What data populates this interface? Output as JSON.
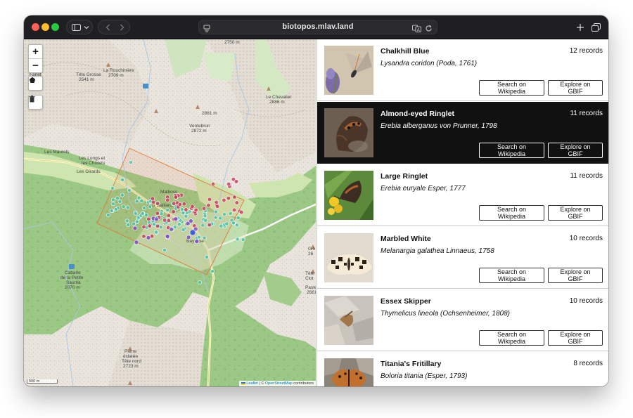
{
  "browser": {
    "url": "biotopos.mlav.land"
  },
  "map": {
    "zoom_in": "+",
    "zoom_out": "−",
    "attribution_leaflet": "Leaflet",
    "attribution_sep": " | © ",
    "attribution_osm": "OpenStreetMap",
    "attribution_tail": " contributors",
    "scale_label": "500 m",
    "places": [
      {
        "name": "2750 m"
      },
      {
        "name": "Tête Grosse"
      },
      {
        "name": "2541 m"
      },
      {
        "name": "La Rouchinière"
      },
      {
        "name": "2709 m"
      },
      {
        "name": "Le Chevalier"
      },
      {
        "name": "2886 m"
      },
      {
        "name": "2881 m"
      },
      {
        "name": "Ventebrun"
      },
      {
        "name": "2872 m"
      },
      {
        "name": "Les Maurels"
      },
      {
        "name": "Les Longs et"
      },
      {
        "name": "les Chiclets"
      },
      {
        "name": "Les Girards"
      },
      {
        "name": "Malbosc"
      },
      {
        "name": "Les Gaillards"
      },
      {
        "name": "Bayasse"
      },
      {
        "name": "Cabane"
      },
      {
        "name": "de la Petite"
      },
      {
        "name": "Sauma"
      },
      {
        "name": "2070 m"
      },
      {
        "name": "Pierre"
      },
      {
        "name": "éclatée"
      },
      {
        "name": "Tête nord"
      },
      {
        "name": "2723 m"
      },
      {
        "name": "Fanet"
      },
      {
        "name": "Glo"
      },
      {
        "name": "26"
      },
      {
        "name": "Tête"
      },
      {
        "name": "Clot"
      },
      {
        "name": "Paste"
      },
      {
        "name": "2661"
      }
    ]
  },
  "species_list": [
    {
      "common": "Chalkhill Blue",
      "scientific": "Lysandra coridon (Poda, 1761)",
      "records": "12 records",
      "wiki": "Search on Wikipedia",
      "gbif": "Explore on GBIF"
    },
    {
      "common": "Almond-eyed Ringlet",
      "scientific": "Erebia alberganus von Prunner, 1798",
      "records": "11 records",
      "wiki": "Search on Wikipedia",
      "gbif": "Explore on GBIF"
    },
    {
      "common": "Large Ringlet",
      "scientific": "Erebia euryale Esper, 1777",
      "records": "11 records",
      "wiki": "Search on Wikipedia",
      "gbif": "Explore on GBIF"
    },
    {
      "common": "Marbled White",
      "scientific": "Melanargia galathea Linnaeus, 1758",
      "records": "10 records",
      "wiki": "Search on Wikipedia",
      "gbif": "Explore on GBIF"
    },
    {
      "common": "Essex Skipper",
      "scientific": "Thymelicus lineola (Ochsenheimer, 1808)",
      "records": "10 records",
      "wiki": "Search on Wikipedia",
      "gbif": "Explore on GBIF"
    },
    {
      "common": "Titania's Fritillary",
      "scientific": "Boloria titania (Esper, 1793)",
      "records": "8 records",
      "wiki": "Search on Wikipedia",
      "gbif": "Explore on GBIF"
    }
  ],
  "colors": {
    "selected_card": "#111111",
    "forest": "#a8cf8f",
    "marker_teal": "#4fc0a8",
    "marker_red": "#c8395a",
    "marker_violet": "#7c45c8",
    "selection_box": "#e07a3a"
  }
}
